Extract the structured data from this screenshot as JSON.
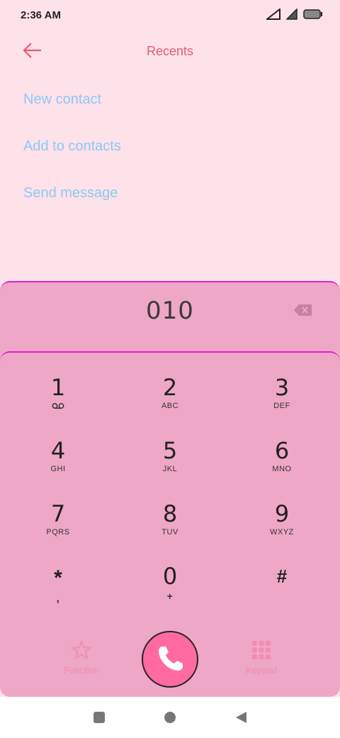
{
  "status": {
    "time": "2:36 AM"
  },
  "header": {
    "title": "Recents",
    "back_icon": "arrow-left-icon"
  },
  "menu": {
    "items": [
      {
        "label": "New contact"
      },
      {
        "label": "Add to contacts"
      },
      {
        "label": "Send message"
      }
    ]
  },
  "dialer": {
    "number": "010",
    "keys": [
      {
        "digit": "1",
        "letters": ""
      },
      {
        "digit": "2",
        "letters": "ABC"
      },
      {
        "digit": "3",
        "letters": "DEF"
      },
      {
        "digit": "4",
        "letters": "GHI"
      },
      {
        "digit": "5",
        "letters": "JKL"
      },
      {
        "digit": "6",
        "letters": "MNO"
      },
      {
        "digit": "7",
        "letters": "PQRS"
      },
      {
        "digit": "8",
        "letters": "TUV"
      },
      {
        "digit": "9",
        "letters": "WXYZ"
      },
      {
        "digit": "*",
        "letters": ","
      },
      {
        "digit": "0",
        "letters": "+"
      },
      {
        "digit": "#",
        "letters": ""
      }
    ],
    "function_label": "Function",
    "keypad_label": "Keypad"
  },
  "colors": {
    "accent": "#e45d6e",
    "link": "#8ec8f5",
    "panel": "#eea7c6",
    "border": "#e01ed6",
    "call": "#ff6a9f"
  }
}
